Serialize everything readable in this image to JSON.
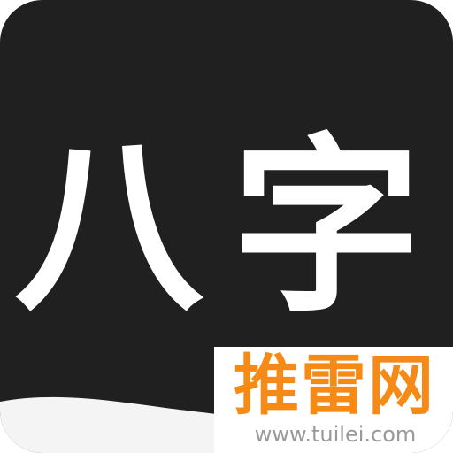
{
  "icon": {
    "background": "#202020",
    "characters": [
      "八",
      "字"
    ]
  },
  "watermark": {
    "logo": "推雷网",
    "url": "www.tuilei.com",
    "accent": "#f58a17",
    "url_color": "#999999"
  }
}
